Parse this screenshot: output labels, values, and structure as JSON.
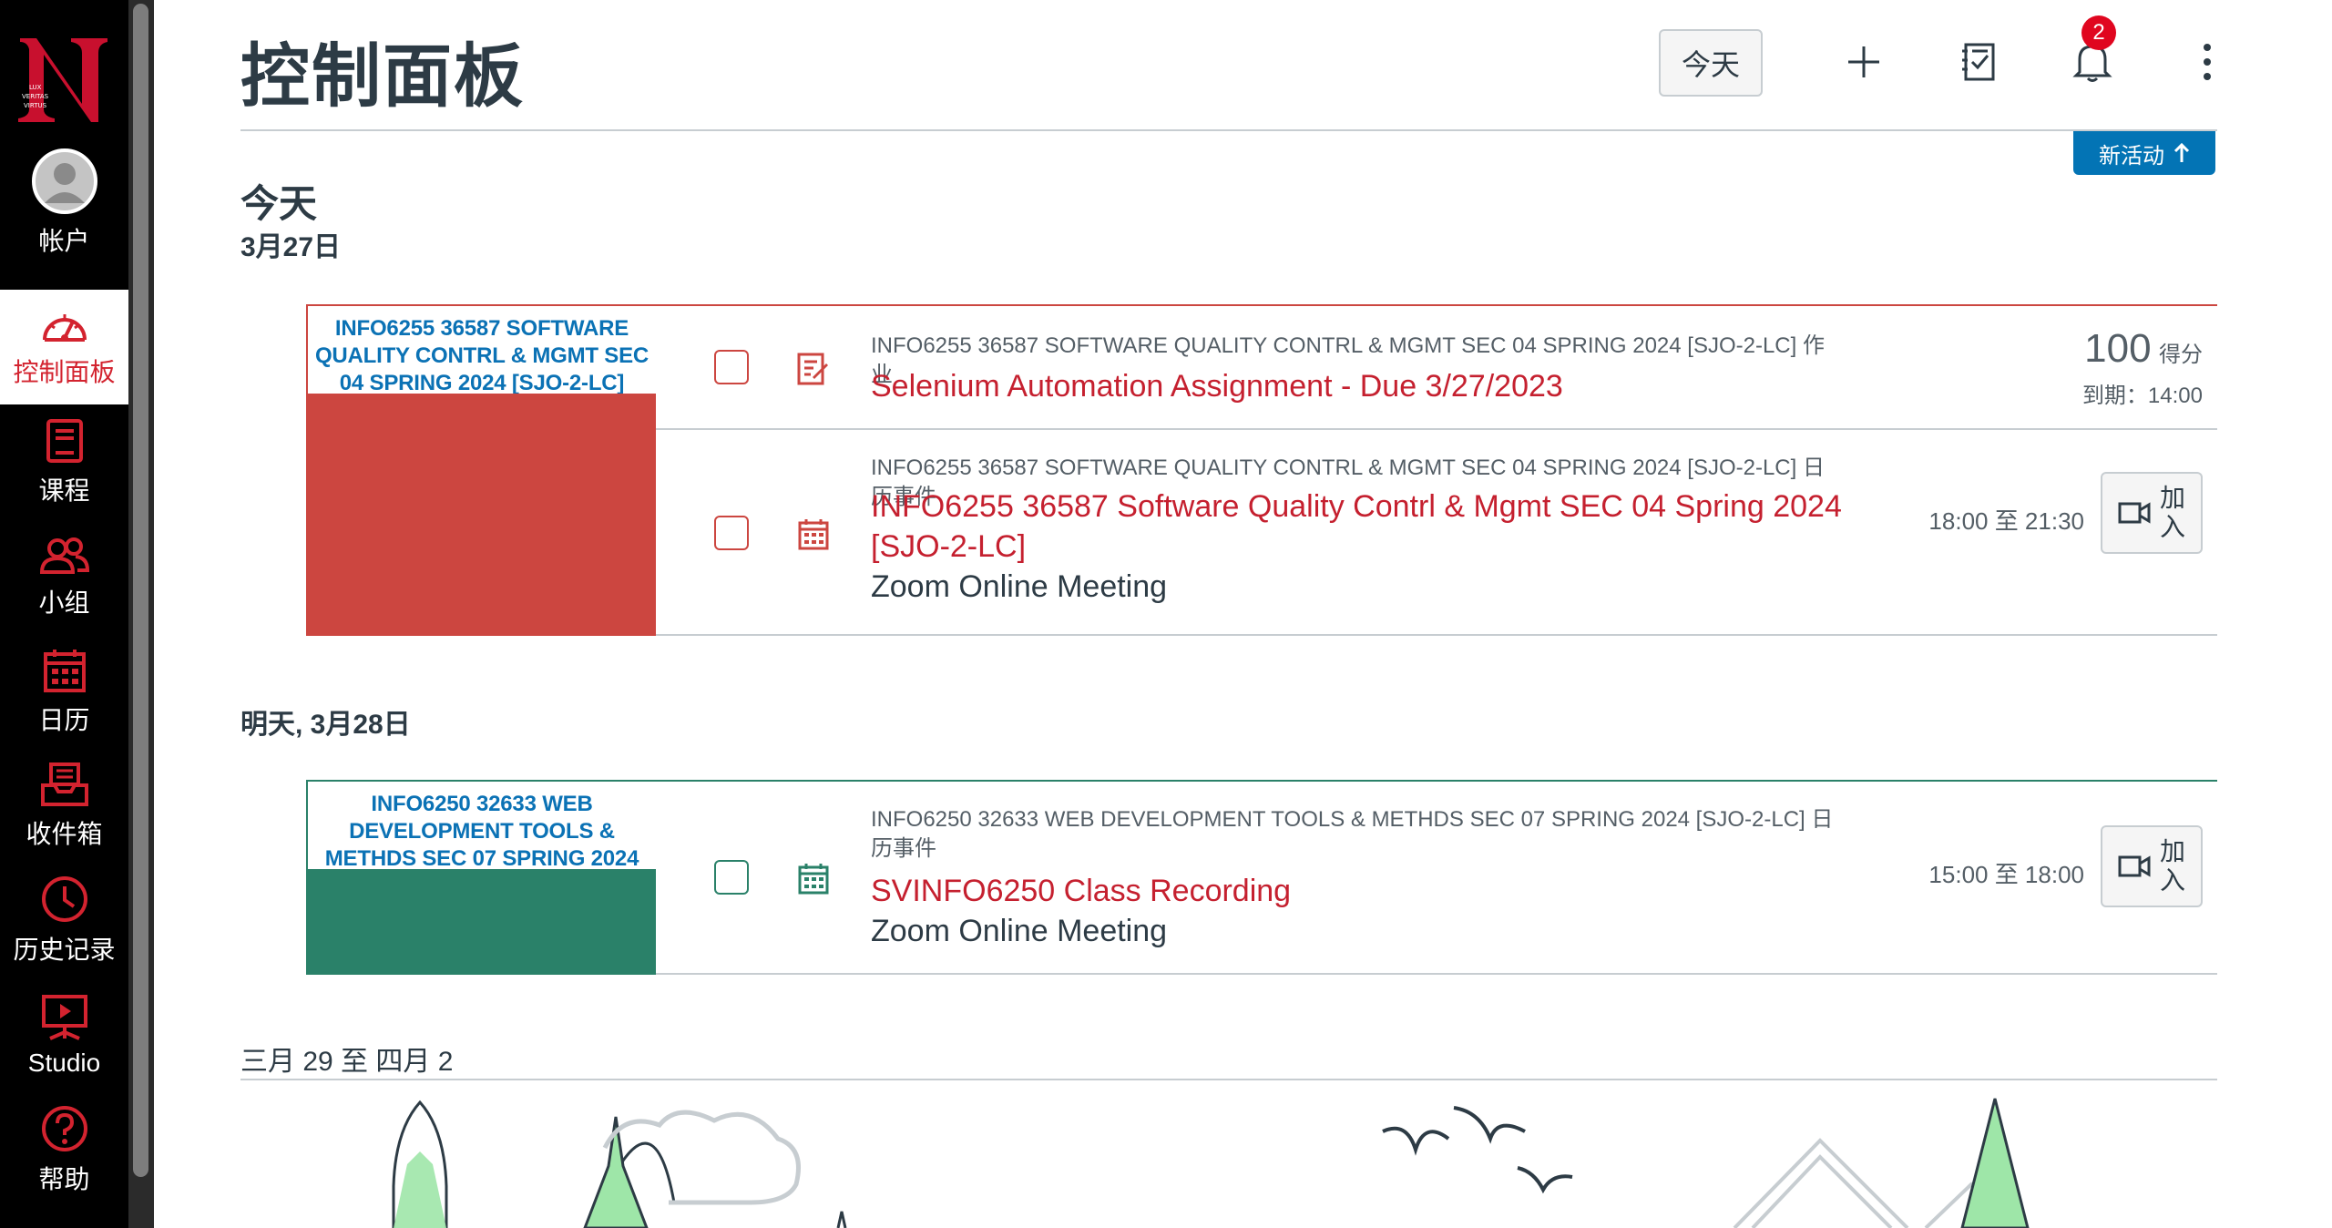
{
  "nav": {
    "items": [
      {
        "label": "帐户",
        "icon": "avatar"
      },
      {
        "label": "控制面板",
        "icon": "dashboard-icon",
        "active": true
      },
      {
        "label": "课程",
        "icon": "courses-icon"
      },
      {
        "label": "小组",
        "icon": "groups-icon"
      },
      {
        "label": "日历",
        "icon": "calendar-icon"
      },
      {
        "label": "收件箱",
        "icon": "inbox-icon"
      },
      {
        "label": "历史记录",
        "icon": "history-icon"
      },
      {
        "label": "Studio",
        "icon": "studio-icon"
      },
      {
        "label": "帮助",
        "icon": "help-icon"
      }
    ],
    "accent": "#d3232f"
  },
  "header": {
    "title": "控制面板",
    "today_button": "今天",
    "notification_count": "2",
    "new_activity": "新活动"
  },
  "days": [
    {
      "heading": "今天",
      "date": "3月27日",
      "course": {
        "name": "INFO6255 36587 SOFTWARE QUALITY CONTRL & MGMT SEC 04 SPRING 2024 [SJO-2-LC]",
        "color": "#cc4640"
      },
      "items": [
        {
          "meta": "INFO6255 36587 SOFTWARE QUALITY CONTRL & MGMT SEC 04 SPRING 2024 [SJO-2-LC] 作业",
          "title": "Selenium Automation Assignment - Due 3/27/2023",
          "points": "100",
          "points_label": "得分",
          "due": "到期：14:00",
          "icon": "assignment-icon"
        },
        {
          "meta": "INFO6255 36587 SOFTWARE QUALITY CONTRL & MGMT SEC 04 SPRING 2024 [SJO-2-LC] 日历事件",
          "title": "INFO6255 36587 Software Quality Contrl & Mgmt SEC 04 Spring 2024 [SJO-2-LC]",
          "location": "Zoom Online Meeting",
          "time": "18:00 至 21:30",
          "join": "加入",
          "icon": "calendar-event-icon"
        }
      ]
    },
    {
      "heading": "明天, 3月28日",
      "course": {
        "name": "INFO6250 32633 WEB DEVELOPMENT TOOLS & METHDS SEC 07 SPRING 2024 [SJO-2-LC]",
        "color": "#2a8169"
      },
      "items": [
        {
          "meta": "INFO6250 32633 WEB DEVELOPMENT TOOLS & METHDS SEC 07 SPRING 2024 [SJO-2-LC] 日历事件",
          "title": "SVINFO6250 Class Recording",
          "location": "Zoom Online Meeting",
          "time": "15:00 至 18:00",
          "join": "加入",
          "icon": "calendar-event-icon"
        }
      ]
    },
    {
      "heading": "三月 29 至 四月 2"
    }
  ],
  "colors": {
    "link_red": "#c5202f",
    "link_blue": "#0b72b5",
    "text": "#2d3b45",
    "muted": "#545e66"
  }
}
